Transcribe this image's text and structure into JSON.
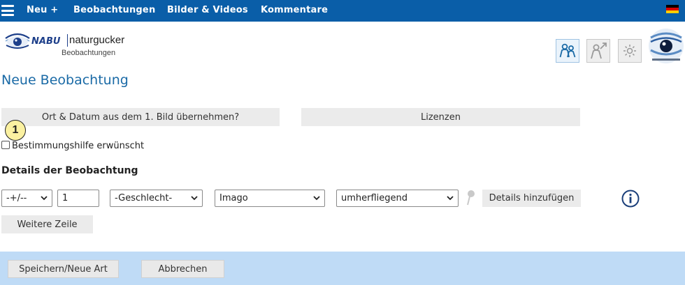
{
  "nav": {
    "items": [
      "Neu +",
      "Beobachtungen",
      "Bilder & Videos",
      "Kommentare"
    ],
    "flag_colors": [
      "#000000",
      "#dd0000",
      "#ffce00"
    ]
  },
  "logo": {
    "brand": "NABU",
    "name": "naturgucker",
    "sub": "Beobachtungen"
  },
  "header_icons": [
    "people-icon",
    "person-share-icon",
    "settings-sun-icon"
  ],
  "title": "Neue Beobachtung",
  "buttons": {
    "take_from_image": "Ort & Datum aus dem 1. Bild übernehmen?",
    "licenses": "Lizenzen"
  },
  "annotation_badge": "1",
  "checkbox": {
    "label": "Bestimmungshilfe erwünscht",
    "checked": false
  },
  "details": {
    "heading": "Details der Beobachtung",
    "quantity_prefix": "-+/--",
    "quantity": "1",
    "sex": "-Geschlecht-",
    "stage": "Imago",
    "behavior": "umherfliegend",
    "add_details": "Details hinzufügen"
  },
  "more_row": "Weitere Zeile",
  "footer": {
    "save": "Speichern/Neue Art",
    "cancel": "Abbrechen"
  },
  "colors": {
    "nav_bg": "#0a5ea8",
    "title": "#1a6aa6",
    "footer_bg": "#bfdbf6"
  }
}
